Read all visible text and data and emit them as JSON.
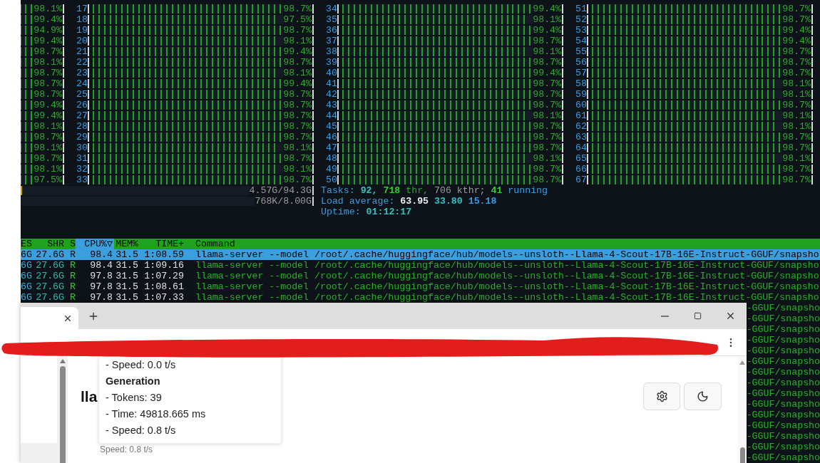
{
  "cpu_columns": [
    {
      "meters": [
        {
          "reading": "98.1%"
        },
        {
          "reading": "99.4%"
        },
        {
          "reading": "94.9%"
        },
        {
          "reading": "99.4%"
        },
        {
          "reading": "98.7%"
        },
        {
          "reading": "98.1%"
        },
        {
          "reading": "98.7%"
        },
        {
          "reading": "98.7%"
        },
        {
          "reading": "98.7%"
        },
        {
          "reading": "99.4%"
        },
        {
          "reading": "99.4%"
        },
        {
          "reading": "98.1%"
        },
        {
          "reading": "98.7%"
        },
        {
          "reading": "98.1%"
        },
        {
          "reading": "98.7%"
        },
        {
          "reading": "98.1%"
        },
        {
          "reading": "97.5%"
        }
      ]
    },
    {
      "meters": [
        {
          "label": "17",
          "level": 0.987,
          "reading": "98.7%"
        },
        {
          "label": "18",
          "level": 0.975,
          "reading": "97.5%"
        },
        {
          "label": "19",
          "level": 0.987,
          "reading": "98.7%"
        },
        {
          "label": "20",
          "level": 0.981,
          "reading": "98.1%"
        },
        {
          "label": "21",
          "level": 0.994,
          "reading": "99.4%"
        },
        {
          "label": "22",
          "level": 0.987,
          "reading": "98.7%"
        },
        {
          "label": "23",
          "level": 0.981,
          "reading": "98.1%"
        },
        {
          "label": "24",
          "level": 0.994,
          "reading": "99.4%"
        },
        {
          "label": "25",
          "level": 0.987,
          "reading": "98.7%"
        },
        {
          "label": "26",
          "level": 0.987,
          "reading": "98.7%"
        },
        {
          "label": "27",
          "level": 0.987,
          "reading": "98.7%"
        },
        {
          "label": "28",
          "level": 0.987,
          "reading": "98.7%"
        },
        {
          "label": "29",
          "level": 0.987,
          "reading": "98.7%"
        },
        {
          "label": "30",
          "level": 0.981,
          "reading": "98.1%"
        },
        {
          "label": "31",
          "level": 0.987,
          "reading": "98.7%"
        },
        {
          "label": "32",
          "level": 0.981,
          "reading": "98.1%"
        },
        {
          "label": "33",
          "level": 0.987,
          "reading": "98.7%"
        }
      ]
    },
    {
      "meters": [
        {
          "label": "34",
          "level": 0.994,
          "reading": "99.4%"
        },
        {
          "label": "35",
          "level": 0.981,
          "reading": "98.1%"
        },
        {
          "label": "36",
          "level": 0.994,
          "reading": "99.4%"
        },
        {
          "label": "37",
          "level": 0.987,
          "reading": "98.7%"
        },
        {
          "label": "38",
          "level": 0.981,
          "reading": "98.1%"
        },
        {
          "label": "39",
          "level": 0.987,
          "reading": "98.7%"
        },
        {
          "label": "40",
          "level": 0.994,
          "reading": "99.4%"
        },
        {
          "label": "41",
          "level": 0.987,
          "reading": "98.7%"
        },
        {
          "label": "42",
          "level": 0.987,
          "reading": "98.7%"
        },
        {
          "label": "43",
          "level": 0.987,
          "reading": "98.7%"
        },
        {
          "label": "44",
          "level": 0.981,
          "reading": "98.1%"
        },
        {
          "label": "45",
          "level": 0.987,
          "reading": "98.7%"
        },
        {
          "label": "46",
          "level": 0.987,
          "reading": "98.7%"
        },
        {
          "label": "47",
          "level": 0.987,
          "reading": "98.7%"
        },
        {
          "label": "48",
          "level": 0.981,
          "reading": "98.1%"
        },
        {
          "label": "49",
          "level": 0.987,
          "reading": "98.7%"
        },
        {
          "label": "50",
          "level": 0.987,
          "reading": "98.7%"
        }
      ]
    },
    {
      "meters": [
        {
          "label": "51",
          "level": 0.987,
          "reading": "98.7%"
        },
        {
          "label": "52",
          "level": 0.987,
          "reading": "98.7%"
        },
        {
          "label": "53",
          "level": 0.994,
          "reading": "99.4%"
        },
        {
          "label": "54",
          "level": 0.994,
          "reading": "99.4%"
        },
        {
          "label": "55",
          "level": 0.987,
          "reading": "98.7%"
        },
        {
          "label": "56",
          "level": 0.987,
          "reading": "98.7%"
        },
        {
          "label": "57",
          "level": 0.987,
          "reading": "98.7%"
        },
        {
          "label": "58",
          "level": 0.981,
          "reading": "98.1%"
        },
        {
          "label": "59",
          "level": 0.981,
          "reading": "98.1%"
        },
        {
          "label": "60",
          "level": 0.987,
          "reading": "98.7%"
        },
        {
          "label": "61",
          "level": 0.981,
          "reading": "98.1%"
        },
        {
          "label": "62",
          "level": 0.981,
          "reading": "98.1%"
        },
        {
          "label": "63",
          "level": 0.987,
          "reading": "98.7%"
        },
        {
          "label": "64",
          "level": 0.987,
          "reading": "98.7%"
        },
        {
          "label": "65",
          "level": 0.981,
          "reading": "98.1%"
        },
        {
          "label": "66",
          "level": 0.987,
          "reading": "98.7%"
        },
        {
          "label": "67",
          "level": 0.987,
          "reading": "98.7%"
        }
      ]
    }
  ],
  "memory_meters": [
    {
      "level": 0.02,
      "reading": "4.57G/94.3G"
    },
    {
      "reading": "768K/8.00G"
    }
  ],
  "status_lines": [
    {
      "segments": [
        {
          "text": "Tasks:",
          "color": "#3b9be0",
          "bold": false
        },
        {
          "text": "92,",
          "color": "#36c0c0",
          "bold": true
        },
        {
          "text": "718",
          "color": "#2fcf2f",
          "bold": true
        },
        {
          "text": "thr,",
          "color": "#27a827",
          "bold": false
        },
        {
          "text": "706 kthr;",
          "color": "#9a9a9a",
          "bold": false
        },
        {
          "text": "41",
          "color": "#2fcf2f",
          "bold": true
        },
        {
          "text": "running",
          "color": "#3b9be0",
          "bold": false
        }
      ]
    },
    {
      "segments": [
        {
          "text": "Load average:",
          "color": "#3b9be0",
          "bold": false
        },
        {
          "text": "63.95",
          "color": "#f0f0f0",
          "bold": true
        },
        {
          "text": "33.80",
          "color": "#36c0c0",
          "bold": true
        },
        {
          "text": "15.18",
          "color": "#3b9be0",
          "bold": true
        }
      ]
    },
    {
      "segments": [
        {
          "text": "Uptime:",
          "color": "#3b9be0",
          "bold": false
        },
        {
          "text": "01:12:17",
          "color": "#36c0c0",
          "bold": true
        }
      ]
    }
  ],
  "process_table": {
    "columns": [
      {
        "label": "ES",
        "selected": false
      },
      {
        "label": "SHR",
        "selected": false
      },
      {
        "label": "S",
        "selected": false
      },
      {
        "label": "CPU%▽",
        "selected": true
      },
      {
        "label": "MEM%",
        "selected": false
      },
      {
        "label": "TIME+",
        "selected": false
      },
      {
        "label": "Command",
        "selected": false
      }
    ],
    "rows": [
      {
        "kind": "full",
        "selected": true,
        "cells": [
          "6G",
          "27.6G",
          "R",
          "98.4",
          "31.5",
          "1:08.59",
          "llama-server --model /root/.cache/huggingface/hub/models--unsloth--Llama-4-Scout-17B-16E-Instruct-GGUF/snapsho"
        ]
      },
      {
        "kind": "full",
        "selected": false,
        "cells": [
          "6G",
          "27.6G",
          "R",
          "98.4",
          "31.5",
          "1:09.16",
          "llama-server --model /root/.cache/huggingface/hub/models--unsloth--Llama-4-Scout-17B-16E-Instruct-GGUF/snapsho"
        ]
      },
      {
        "kind": "full",
        "selected": false,
        "cells": [
          "6G",
          "27.6G",
          "R",
          "97.8",
          "31.5",
          "1:07.29",
          "llama-server --model /root/.cache/huggingface/hub/models--unsloth--Llama-4-Scout-17B-16E-Instruct-GGUF/snapsho"
        ]
      },
      {
        "kind": "full",
        "selected": false,
        "cells": [
          "6G",
          "27.6G",
          "R",
          "97.8",
          "31.5",
          "1:08.61",
          "llama-server --model /root/.cache/huggingface/hub/models--unsloth--Llama-4-Scout-17B-16E-Instruct-GGUF/snapsho"
        ]
      },
      {
        "kind": "full",
        "selected": false,
        "cells": [
          "6G",
          "27.6G",
          "R",
          "97.8",
          "31.5",
          "1:07.33",
          "llama-server --model /root/.cache/huggingface/hub/models--unsloth--Llama-4-Scout-17B-16E-Instruct-GGUF/snapsho"
        ]
      },
      {
        "kind": "tail",
        "selected": false,
        "cells": [
          "-GGUF/snapsho"
        ]
      },
      {
        "kind": "tail",
        "selected": false,
        "cells": [
          "-GGUF/snapsho"
        ]
      },
      {
        "kind": "tail",
        "selected": false,
        "cells": [
          "-GGUF/snapsho"
        ]
      },
      {
        "kind": "tail",
        "selected": false,
        "cells": [
          "-GGUF/snapsho"
        ]
      },
      {
        "kind": "tail",
        "selected": false,
        "cells": [
          "-GGUF/snapsho"
        ]
      },
      {
        "kind": "tail",
        "selected": false,
        "cells": [
          "-GGUF/snapsho"
        ]
      },
      {
        "kind": "tail",
        "selected": false,
        "cells": [
          "-GGUF/snapsho"
        ]
      },
      {
        "kind": "tail",
        "selected": false,
        "cells": [
          "-GGUF/snapsho"
        ]
      },
      {
        "kind": "tail",
        "selected": false,
        "cells": [
          "-GGUF/snapsho"
        ]
      },
      {
        "kind": "tail",
        "selected": false,
        "cells": [
          "-GGUF/snapsho"
        ]
      },
      {
        "kind": "tail",
        "selected": false,
        "cells": [
          "-GGUF/snapsho"
        ]
      },
      {
        "kind": "tail",
        "selected": false,
        "cells": [
          "-GGUF/snapsho"
        ]
      },
      {
        "kind": "tail",
        "selected": false,
        "cells": [
          "-GGUF/snapsho"
        ]
      },
      {
        "kind": "tail",
        "selected": false,
        "cells": [
          "-GGUF/snapsho"
        ]
      },
      {
        "kind": "tail",
        "selected": false,
        "cells": [
          "-GGUF/snapsho"
        ]
      }
    ]
  },
  "browser": {
    "page": {
      "heading": "lla",
      "tooltip": {
        "lines": [
          {
            "text": "- Speed: 0.0 t/s",
            "kind": "item"
          },
          {
            "text": "Generation",
            "kind": "heading"
          },
          {
            "text": "- Tokens: 39",
            "kind": "item"
          },
          {
            "text": "- Time: 49818.665 ms",
            "kind": "item"
          },
          {
            "text": "- Speed: 0.8 t/s",
            "kind": "item"
          }
        ]
      },
      "speed_note": "Speed: 0.8 t/s"
    }
  }
}
